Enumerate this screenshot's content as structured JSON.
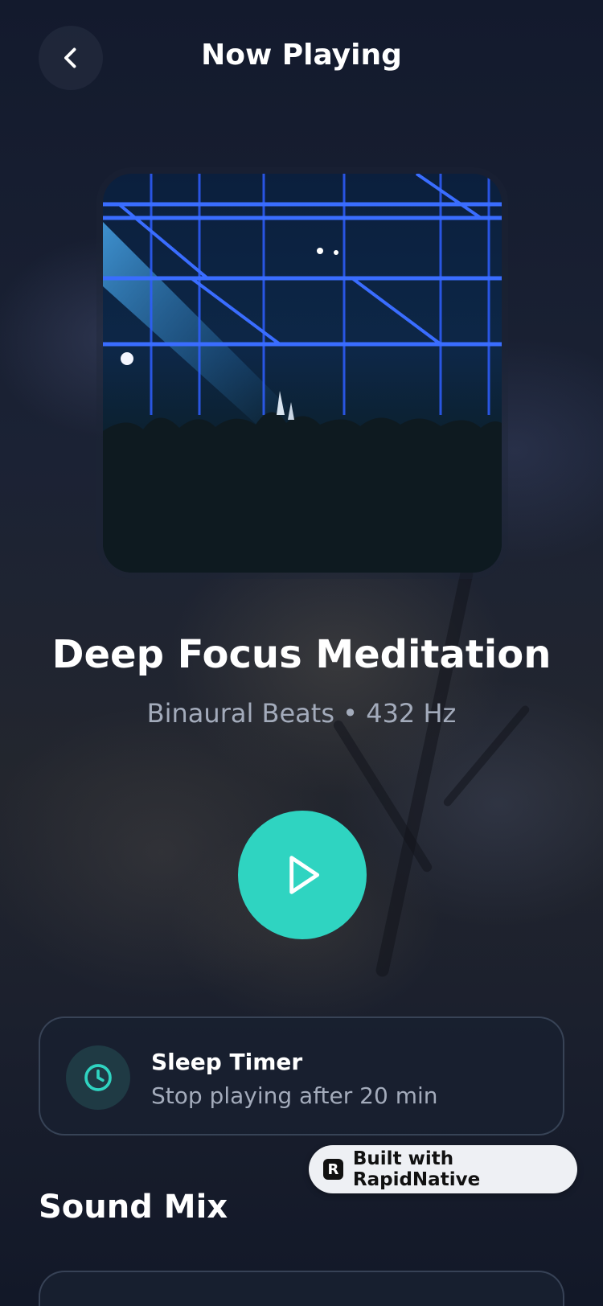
{
  "header": {
    "title": "Now Playing",
    "back_icon": "chevron-left-icon"
  },
  "track": {
    "title": "Deep Focus Meditation",
    "subtitle": "Binaural Beats • 432 Hz",
    "artwork": "concert-stage-image"
  },
  "player": {
    "play_icon": "play-icon",
    "accent_color": "#2fd4c1"
  },
  "sleep_timer": {
    "title": "Sleep Timer",
    "subtitle": "Stop playing after 20 min",
    "icon": "clock-icon"
  },
  "badge": {
    "logo_letter": "R",
    "label": "Built with RapidNative"
  },
  "sound_mix": {
    "title": "Sound Mix"
  }
}
